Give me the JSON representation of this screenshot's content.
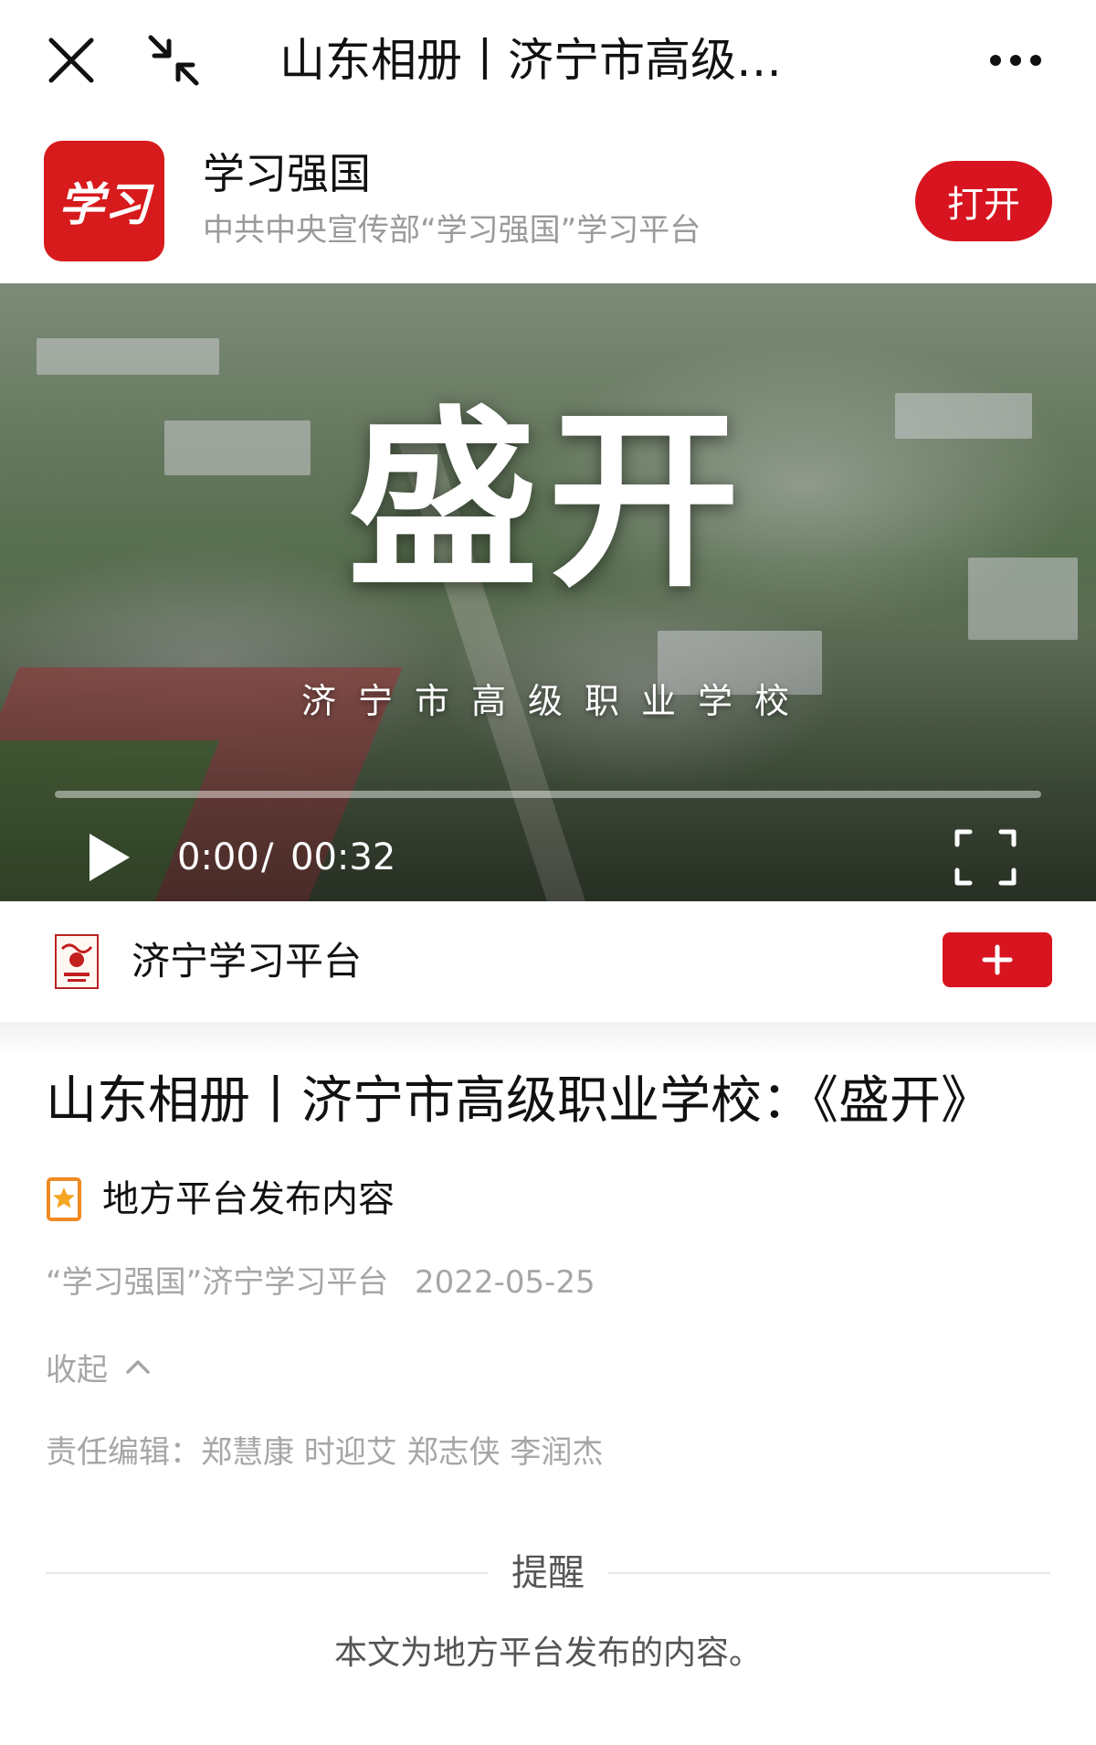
{
  "topbar": {
    "title": "山东相册丨济宁市高级…",
    "close_icon": "close-icon",
    "minimize_icon": "minimize-icon",
    "more_icon": "more-icon"
  },
  "app_banner": {
    "logo_text": "学习",
    "name": "学习强国",
    "description": "中共中央宣传部“学习强国”学习平台",
    "open_label": "打开",
    "accent": "#d7141f"
  },
  "video": {
    "title": "盛开",
    "subtitle": "济宁市高级职业学校",
    "current_time": "0:00",
    "separator": "/",
    "total_time": "00:32",
    "progress": 0,
    "play_icon": "play-icon",
    "fullscreen_icon": "fullscreen-icon"
  },
  "channel": {
    "name": "济宁学习平台",
    "follow_label": "+",
    "logo_icon": "channel-logo-icon"
  },
  "article": {
    "title": "山东相册丨济宁市高级职业学校：《盛开》",
    "source_tag": "地方平台发布内容",
    "source_tag_icon": "star-badge-icon",
    "source": "“学习强国”济宁学习平台",
    "date": "2022-05-25",
    "collapse_label": "收起",
    "collapse_icon": "chevron-up-icon",
    "editors": "责任编辑：郑慧康 时迎艾 郑志侠 李润杰"
  },
  "reminder": {
    "heading": "提醒",
    "text": "本文为地方平台发布的内容。"
  }
}
